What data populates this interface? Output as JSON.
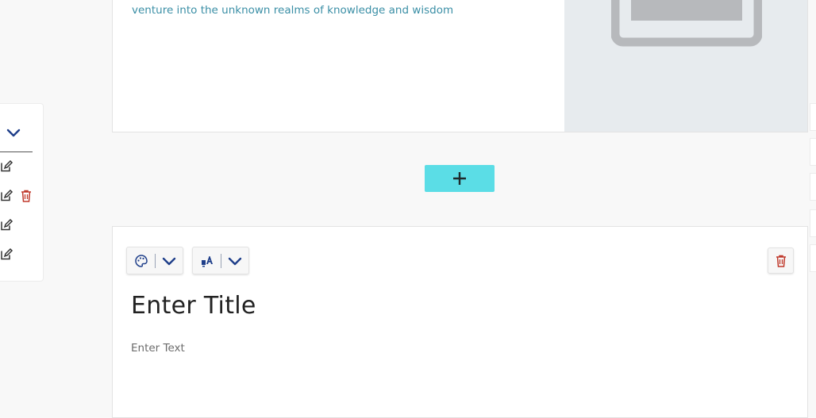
{
  "top_card": {
    "body_text": "questions while seemingly daunting continue to broaden our horizons as we venture into the unknown realms of knowledge and wisdom"
  },
  "add_button": {
    "icon": "plus-icon"
  },
  "new_card": {
    "title": "Enter Title",
    "text": "Enter Text",
    "toolbar": {
      "color_icon": "palette-icon",
      "style_icon": "text-style-icon",
      "dropdown_icon": "chevron-down-icon",
      "delete_icon": "trash-icon"
    }
  },
  "colors": {
    "accent": "#5bdde6",
    "link_text": "#3b8fa6",
    "icon_blue": "#1f3f8a",
    "delete_red": "#c0392b",
    "image_placeholder_bg": "#e7ebee"
  }
}
